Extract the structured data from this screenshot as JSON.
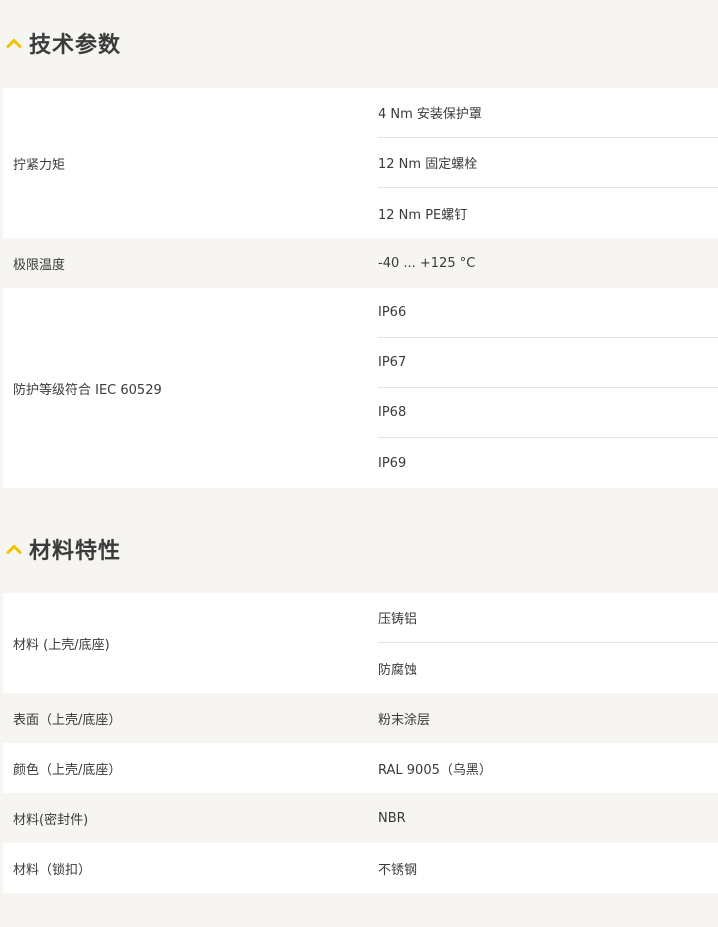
{
  "sections": [
    {
      "title": "技术参数",
      "rows": [
        {
          "label": "拧紧力矩",
          "values": [
            "4 Nm 安装保护罩",
            "12 Nm 固定螺栓",
            "12 Nm PE螺钉"
          ]
        },
        {
          "label": "极限温度",
          "values": [
            "-40 ... +125 °C"
          ]
        },
        {
          "label": "防护等级符合 IEC 60529",
          "values": [
            "IP66",
            "IP67",
            "IP68",
            "IP69"
          ]
        }
      ]
    },
    {
      "title": "材料特性",
      "rows": [
        {
          "label": "材料 (上壳/底座)",
          "values": [
            "压铸铝",
            "防腐蚀"
          ]
        },
        {
          "label": "表面（上壳/底座）",
          "values": [
            "粉末涂层"
          ]
        },
        {
          "label": "颜色（上壳/底座）",
          "values": [
            "RAL 9005（乌黑）"
          ]
        },
        {
          "label": "材料(密封件)",
          "values": [
            "NBR"
          ]
        },
        {
          "label": "材料（锁扣）",
          "values": [
            "不锈钢"
          ]
        }
      ]
    }
  ],
  "icons": {
    "section_toggle": "chevron-up-icon"
  },
  "colors": {
    "accent": "#f2c200",
    "background": "#f6f5f2",
    "row_white": "#ffffff"
  }
}
